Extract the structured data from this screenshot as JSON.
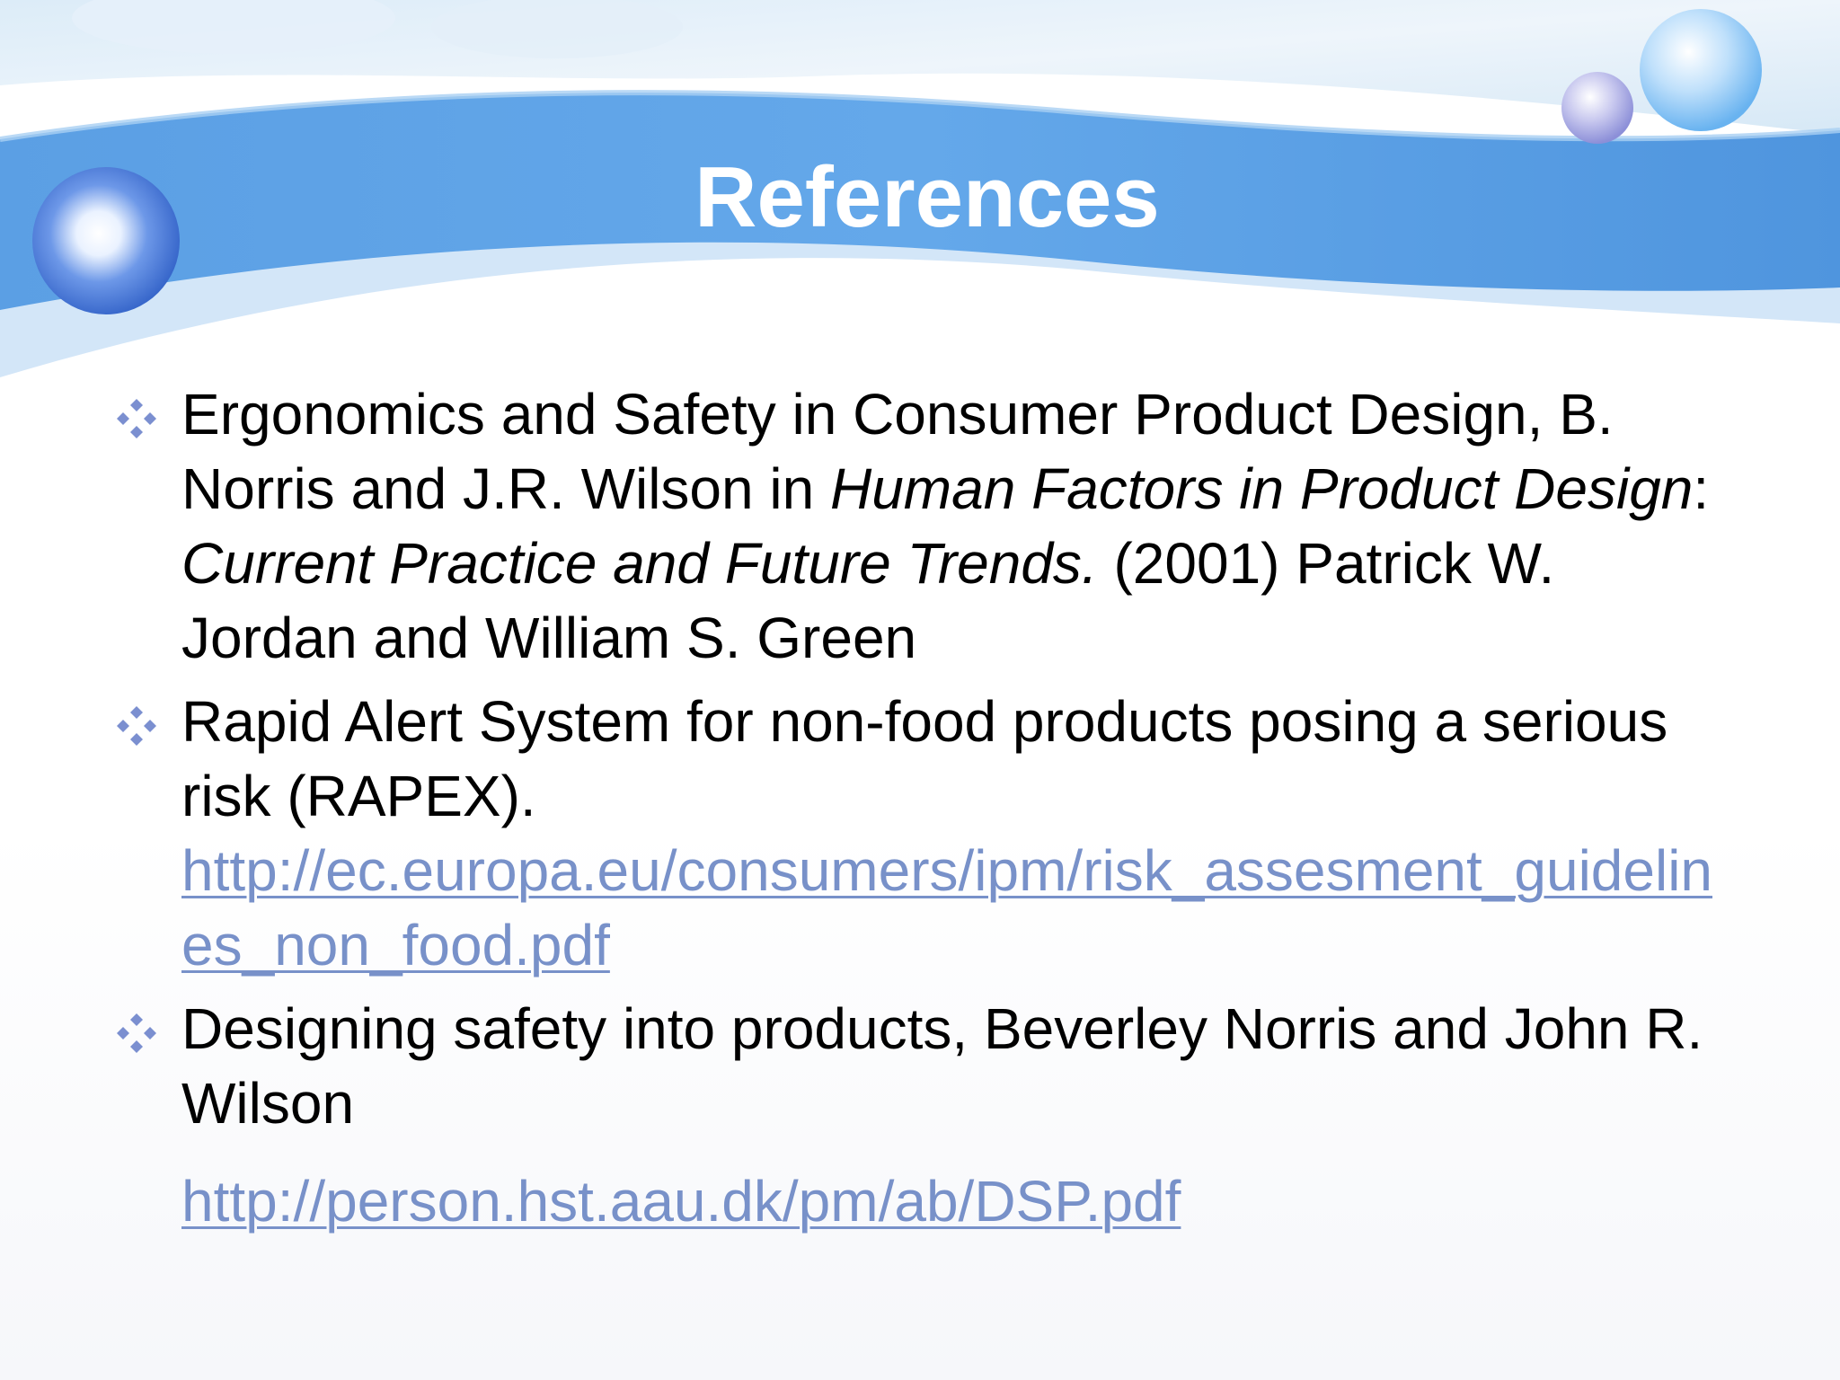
{
  "slide": {
    "title": "References",
    "theme_colors": {
      "banner": "#5da2e6",
      "banner_light": "#b9d8f5",
      "link": "#7891c9",
      "bullet": "#7b8fd0",
      "text": "#000000"
    },
    "bullet_icon": "four-diamond-bullet-icon"
  },
  "references": [
    {
      "part1": "Ergonomics and Safety in Consumer Product Design, B. Norris and J.R. Wilson in ",
      "italic1": "Human Factors in Product Design",
      "sep": ": ",
      "italic2": "Current Practice and Future Trends.",
      "part2": " (2001) Patrick W. Jordan and William S. Green"
    },
    {
      "text": "Rapid Alert System for non-food products posing a serious risk (RAPEX).",
      "link": "http://ec.europa.eu/consumers/ipm/risk_assesment_guidelines_non_food.pdf"
    },
    {
      "text": "Designing safety into products, Beverley Norris and John R. Wilson",
      "link": "http://person.hst.aau.dk/pm/ab/DSP.pdf"
    }
  ]
}
